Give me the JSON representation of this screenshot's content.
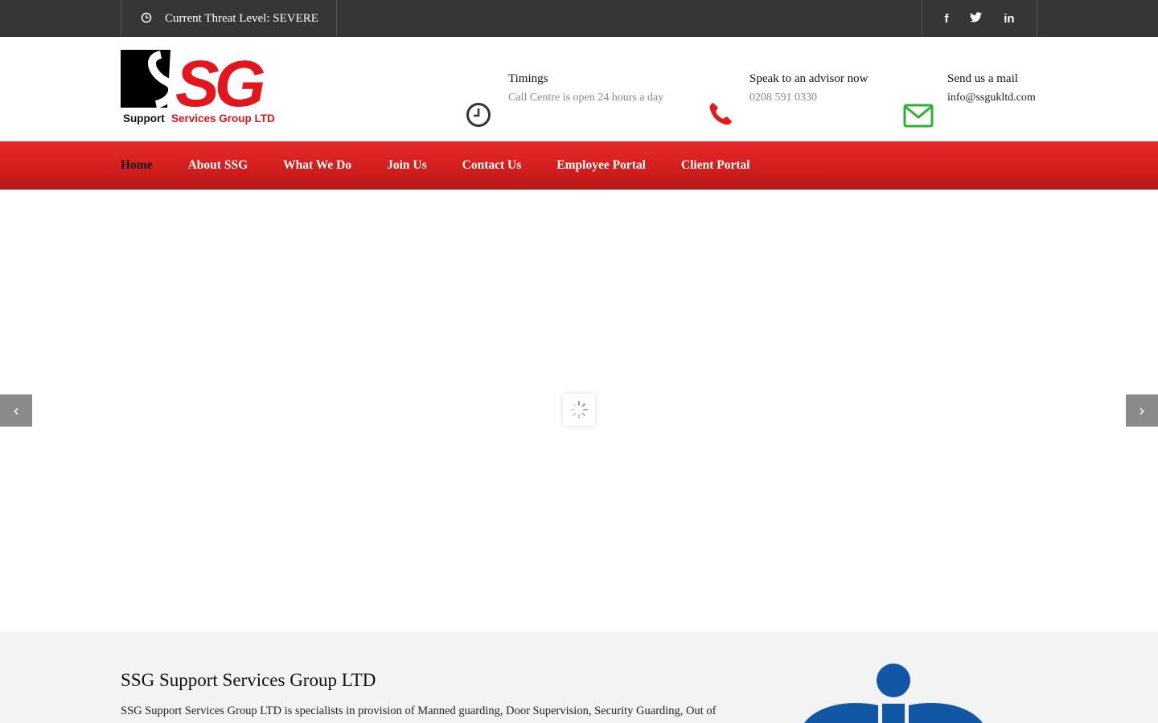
{
  "topbar": {
    "threat_text": "Current Threat Level: SEVERE",
    "social": [
      {
        "icon": "facebook-icon",
        "glyph": "f"
      },
      {
        "icon": "twitter-icon",
        "glyph": "t"
      },
      {
        "icon": "linkedin-icon",
        "glyph": "in"
      }
    ]
  },
  "logo": {
    "letters": "SSG",
    "tagline_word1": "Support",
    "tagline_rest": "Services Group LTD"
  },
  "contact": {
    "timings": {
      "label": "Timings",
      "value": "Call Centre is open 24 hours a day",
      "icon": "clock-icon"
    },
    "advisor": {
      "label": "Speak to an advisor now",
      "value": "0208 591 0330",
      "icon": "phone-icon"
    },
    "mail": {
      "label": "Send us a mail",
      "value": "info@ssgukltd.com",
      "icon": "envelope-icon"
    }
  },
  "nav": {
    "items": [
      {
        "label": "Home",
        "active": true
      },
      {
        "label": "About SSG"
      },
      {
        "label": "What We Do"
      },
      {
        "label": "Join Us"
      },
      {
        "label": "Contact Us"
      },
      {
        "label": "Employee Portal"
      },
      {
        "label": "Client Portal"
      }
    ]
  },
  "slider": {
    "prev": "‹",
    "next": "›"
  },
  "about": {
    "title": "SSG Support Services Group LTD",
    "text": "SSG Support Services Group LTD is specialists in provision of Manned guarding, Door Supervision, Security Guarding, Out of"
  },
  "colors": {
    "topbar": "#363636",
    "nav_red": "#d82020",
    "logo_red": "#e3161e",
    "phone_red": "#e31b1b",
    "mail_green": "#2fb02f",
    "sia_blue": "#1157a6"
  }
}
